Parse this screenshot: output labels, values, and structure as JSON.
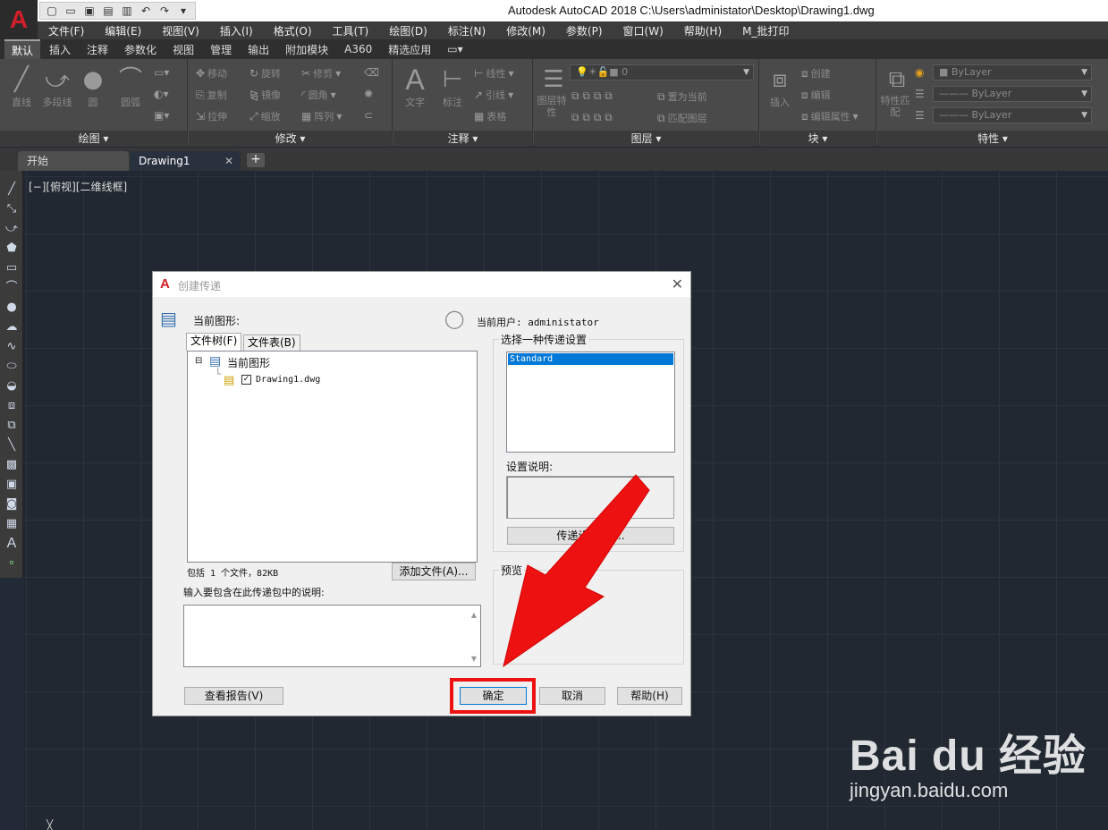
{
  "app": {
    "logo_letter": "A",
    "title": "Autodesk AutoCAD 2018     C:\\Users\\administator\\Desktop\\Drawing1.dwg"
  },
  "menu": [
    "文件(F)",
    "编辑(E)",
    "视图(V)",
    "插入(I)",
    "格式(O)",
    "工具(T)",
    "绘图(D)",
    "标注(N)",
    "修改(M)",
    "参数(P)",
    "窗口(W)",
    "帮助(H)",
    "M_批打印"
  ],
  "ribbon_tabs": [
    "默认",
    "插入",
    "注释",
    "参数化",
    "视图",
    "管理",
    "输出",
    "附加模块",
    "A360",
    "精选应用"
  ],
  "ribbon": {
    "draw": {
      "title": "绘图 ▾",
      "line": "直线",
      "polyline": "多段线",
      "circle": "圆",
      "arc": "圆弧"
    },
    "modify": {
      "title": "修改 ▾",
      "move": "移动",
      "rotate": "旋转",
      "trim": "修剪",
      "copy": "复制",
      "mirror": "镜像",
      "fillet": "圆角",
      "stretch": "拉伸",
      "scale": "缩放",
      "array": "阵列"
    },
    "annotation": {
      "title": "注释 ▾",
      "text": "文字",
      "dimension": "标注",
      "linear": "线性",
      "leader": "引线",
      "table": "表格"
    },
    "layers": {
      "title": "图层 ▾",
      "layer_props": "图层特性",
      "current_layer": "0",
      "set_current": "置为当前",
      "match_layer": "匹配图层"
    },
    "block": {
      "title": "块 ▾",
      "insert": "插入",
      "create": "创建",
      "edit": "编辑",
      "edit_attr": "编辑属性"
    },
    "properties": {
      "title": "特性 ▾",
      "match": "特性匹配",
      "bylayer1": "ByLayer",
      "bylayer2": "ByLayer",
      "bylayer3": "ByLayer"
    }
  },
  "file_tabs": {
    "start": "开始",
    "drawing": "Drawing1",
    "close": "✕",
    "new": "+"
  },
  "viewport_label": "[−][俯视][二维线框]",
  "dialog": {
    "title": "创建传递",
    "close": "✕",
    "current_drawing_label": "当前图形:",
    "current_user_label": "当前用户: administator",
    "tab_tree": "文件树(F)",
    "tab_table": "文件表(B)",
    "tree_root": "当前图形",
    "tree_file": "Drawing1.dwg",
    "summary": "包括 1 个文件，82KB",
    "add_file_button": "添加文件(A)...",
    "notes_label": "输入要包含在此传递包中的说明:",
    "setup_group": "选择一种传递设置",
    "setup_selected": "Standard",
    "setup_desc_label": "设置说明:",
    "setup_button": "传递设置(T)...",
    "preview_group": "预览",
    "view_report_button": "查看报告(V)",
    "ok_button": "确定",
    "cancel_button": "取消",
    "help_button": "帮助(H)"
  },
  "watermark": {
    "logo": "Bai du 经验",
    "url": "jingyan.baidu.com"
  },
  "colors": {
    "accent_red": "#ee1111",
    "selection_blue": "#0078d7",
    "canvas": "#212831",
    "logo_red": "#d21f2a"
  }
}
